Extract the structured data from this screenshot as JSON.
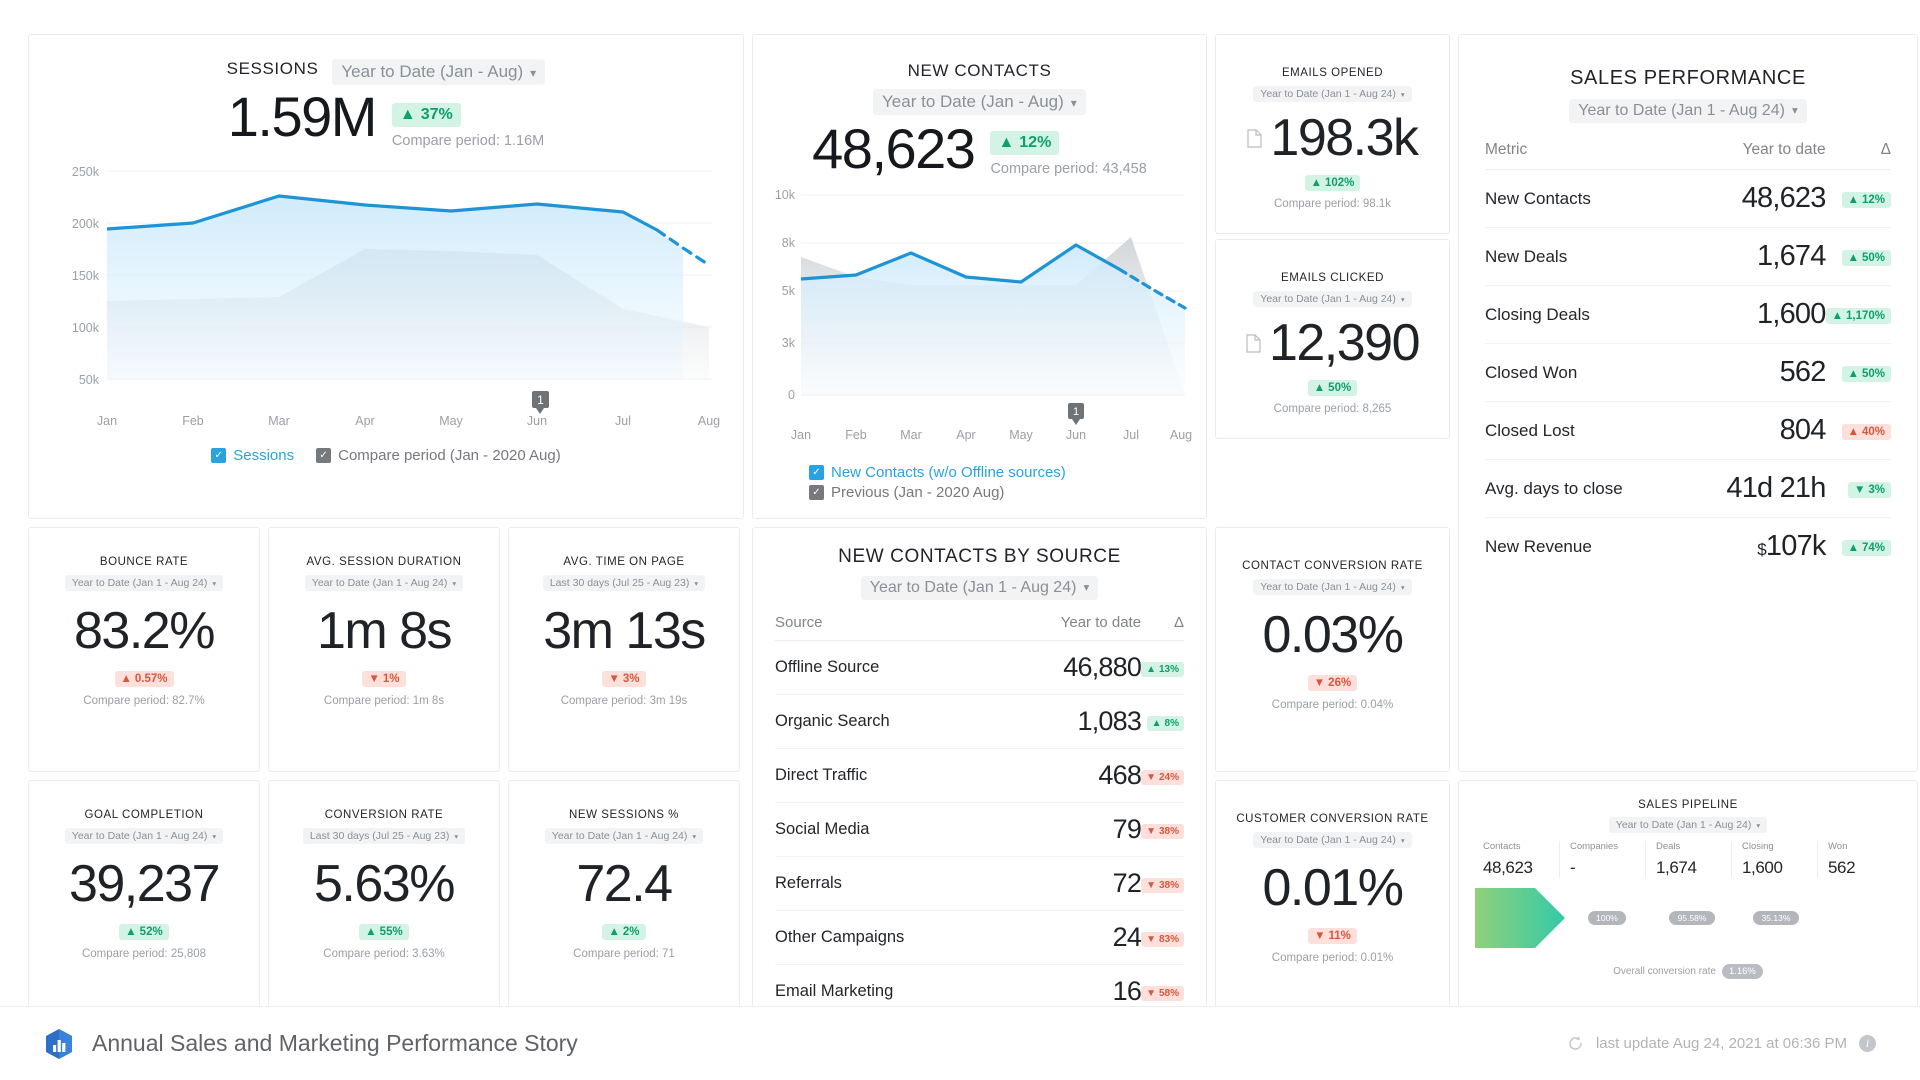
{
  "sessions": {
    "title": "SESSIONS",
    "period": "Year to Date (Jan - Aug)",
    "value": "1.59M",
    "delta": "37%",
    "delta_dir": "up",
    "compare": "Compare period: 1.16M",
    "legend": [
      {
        "label": "Sessions",
        "color": "blue"
      },
      {
        "label": "Compare period (Jan - 2020 Aug)",
        "color": "gray"
      }
    ]
  },
  "new_contacts": {
    "title": "NEW CONTACTS",
    "period": "Year to Date (Jan - Aug)",
    "value": "48,623",
    "delta": "12%",
    "delta_dir": "up",
    "compare": "Compare period: 43,458",
    "legend": [
      {
        "label": "New Contacts (w/o Offline sources)",
        "color": "blue"
      },
      {
        "label": "Previous (Jan - 2020 Aug)",
        "color": "gray"
      }
    ]
  },
  "emails_opened": {
    "title": "EMAILS OPENED",
    "period": "Year to Date (Jan 1 - Aug 24)",
    "value": "198.3k",
    "delta": "102%",
    "delta_dir": "up",
    "compare": "Compare period: 98.1k"
  },
  "emails_clicked": {
    "title": "EMAILS CLICKED",
    "period": "Year to Date (Jan 1 - Aug 24)",
    "value": "12,390",
    "delta": "50%",
    "delta_dir": "up",
    "compare": "Compare period: 8,265"
  },
  "sales_performance": {
    "title": "SALES PERFORMANCE",
    "period": "Year to Date (Jan 1 - Aug 24)",
    "columns": {
      "metric": "Metric",
      "value": "Year to date",
      "delta": "Δ"
    },
    "rows": [
      {
        "metric": "New Contacts",
        "value": "48,623",
        "currency": "",
        "delta": "12%",
        "dir": "up",
        "arrow": "▲",
        "tone": "up"
      },
      {
        "metric": "New Deals",
        "value": "1,674",
        "currency": "",
        "delta": "50%",
        "dir": "up",
        "arrow": "▲",
        "tone": "up"
      },
      {
        "metric": "Closing Deals",
        "value": "1,600",
        "currency": "",
        "delta": "1,170%",
        "dir": "up",
        "arrow": "▲",
        "tone": "up"
      },
      {
        "metric": "Closed Won",
        "value": "562",
        "currency": "",
        "delta": "50%",
        "dir": "up",
        "arrow": "▲",
        "tone": "up"
      },
      {
        "metric": "Closed Lost",
        "value": "804",
        "currency": "",
        "delta": "40%",
        "dir": "up",
        "arrow": "▲",
        "tone": "down"
      },
      {
        "metric": "Avg. days to close",
        "value": "41d 21h",
        "currency": "",
        "delta": "3%",
        "dir": "down",
        "arrow": "▼",
        "tone": "up"
      },
      {
        "metric": "New Revenue",
        "value": "107k",
        "currency": "$",
        "delta": "74%",
        "dir": "up",
        "arrow": "▲",
        "tone": "up"
      }
    ]
  },
  "kpis": [
    {
      "id": "bounce-rate",
      "title": "BOUNCE RATE",
      "period": "Year to Date (Jan 1 - Aug 24)",
      "value": "83.2%",
      "delta": "0.57%",
      "arrow": "▲",
      "tone": "down",
      "compare": "Compare period: 82.7%"
    },
    {
      "id": "avg-session",
      "title": "AVG. SESSION DURATION",
      "period": "Year to Date (Jan 1 - Aug 24)",
      "value": "1m 8s",
      "delta": "1%",
      "arrow": "▼",
      "tone": "down",
      "compare": "Compare period: 1m 8s"
    },
    {
      "id": "avg-time",
      "title": "AVG. TIME ON PAGE",
      "period": "Last 30 days (Jul 25 - Aug 23)",
      "value": "3m 13s",
      "delta": "3%",
      "arrow": "▼",
      "tone": "down",
      "compare": "Compare period: 3m 19s"
    },
    {
      "id": "goal-completion",
      "title": "GOAL COMPLETION",
      "period": "Year to Date (Jan 1 - Aug 24)",
      "value": "39,237",
      "delta": "52%",
      "arrow": "▲",
      "tone": "up",
      "compare": "Compare period: 25,808"
    },
    {
      "id": "conversion-rate",
      "title": "CONVERSION RATE",
      "period": "Last 30 days (Jul 25 - Aug 23)",
      "value": "5.63%",
      "delta": "55%",
      "arrow": "▲",
      "tone": "up",
      "compare": "Compare period: 3.63%"
    },
    {
      "id": "new-sessions",
      "title": "NEW SESSIONS %",
      "period": "Year to Date (Jan 1 - Aug 24)",
      "value": "72.4",
      "delta": "2%",
      "arrow": "▲",
      "tone": "up",
      "compare": "Compare period: 71"
    }
  ],
  "contacts_by_source": {
    "title": "NEW CONTACTS BY SOURCE",
    "period": "Year to Date (Jan 1 - Aug 24)",
    "columns": {
      "source": "Source",
      "value": "Year to date",
      "delta": "Δ"
    },
    "rows": [
      {
        "source": "Offline Source",
        "value": "46,880",
        "delta": "13%",
        "arrow": "▲",
        "tone": "up"
      },
      {
        "source": "Organic Search",
        "value": "1,083",
        "delta": "8%",
        "arrow": "▲",
        "tone": "up"
      },
      {
        "source": "Direct Traffic",
        "value": "468",
        "delta": "24%",
        "arrow": "▼",
        "tone": "down"
      },
      {
        "source": "Social Media",
        "value": "79",
        "delta": "38%",
        "arrow": "▼",
        "tone": "down"
      },
      {
        "source": "Referrals",
        "value": "72",
        "delta": "38%",
        "arrow": "▼",
        "tone": "down"
      },
      {
        "source": "Other Campaigns",
        "value": "24",
        "delta": "83%",
        "arrow": "▼",
        "tone": "down"
      },
      {
        "source": "Email Marketing",
        "value": "16",
        "delta": "58%",
        "arrow": "▼",
        "tone": "down"
      }
    ]
  },
  "contact_conversion": {
    "title": "CONTACT CONVERSION RATE",
    "period": "Year to Date (Jan 1 - Aug 24)",
    "value": "0.03%",
    "delta": "26%",
    "arrow": "▼",
    "tone": "down",
    "compare": "Compare period: 0.04%"
  },
  "customer_conversion": {
    "title": "CUSTOMER CONVERSION RATE",
    "period": "Year to Date (Jan 1 - Aug 24)",
    "value": "0.01%",
    "delta": "11%",
    "arrow": "▼",
    "tone": "down",
    "compare": "Compare period: 0.01%"
  },
  "pipeline": {
    "title": "SALES PIPELINE",
    "period": "Year to Date (Jan 1 - Aug 24)",
    "stages": [
      {
        "label": "Contacts",
        "value": "48,623",
        "rate": ""
      },
      {
        "label": "Companies",
        "value": "-",
        "rate": ""
      },
      {
        "label": "Deals",
        "value": "1,674",
        "rate": "100%"
      },
      {
        "label": "Closing",
        "value": "1,600",
        "rate": "95.58%"
      },
      {
        "label": "Won",
        "value": "562",
        "rate": "35.13%"
      }
    ],
    "overall_label": "Overall conversion rate",
    "overall_value": "1.16%"
  },
  "footer": {
    "title": "Annual Sales and Marketing Performance Story",
    "last_update": "last update Aug 24, 2021 at 06:36 PM"
  },
  "colors": {
    "accent_blue": "#29a3e0",
    "up_bg": "#d3f3e4",
    "up_fg": "#0e9f6e",
    "down_bg": "#fde0db",
    "down_fg": "#d7563c"
  },
  "chart_data": [
    {
      "type": "area",
      "title": "SESSIONS",
      "categories": [
        "Jan",
        "Feb",
        "Mar",
        "Apr",
        "May",
        "Jun",
        "Jul",
        "Aug"
      ],
      "ylim": [
        50000,
        250000
      ],
      "yticks": [
        50000,
        100000,
        150000,
        200000,
        250000
      ],
      "ytick_labels": [
        "50k",
        "100k",
        "150k",
        "200k",
        "250k"
      ],
      "xlabel": "",
      "ylabel": "",
      "grid": true,
      "legend_position": "bottom",
      "series": [
        {
          "name": "Sessions",
          "color": "#29a3e0",
          "values": [
            196000,
            202000,
            228000,
            220000,
            214000,
            221000,
            214000,
            180000
          ],
          "forecast_from": 7,
          "forecast_value": 155000
        },
        {
          "name": "Compare period (Jan - 2020 Aug)",
          "color": "#b9bdc1",
          "values": [
            140000,
            142000,
            143000,
            190000,
            188000,
            185000,
            150000,
            133000
          ]
        }
      ]
    },
    {
      "type": "area",
      "title": "NEW CONTACTS",
      "categories": [
        "Jan",
        "Feb",
        "Mar",
        "Apr",
        "May",
        "Jun",
        "Jul",
        "Aug"
      ],
      "ylim": [
        0,
        10000
      ],
      "yticks": [
        0,
        3000,
        5000,
        8000,
        10000
      ],
      "ytick_labels": [
        "0",
        "3k",
        "5k",
        "8k",
        "10k"
      ],
      "xlabel": "",
      "ylabel": "",
      "grid": true,
      "legend_position": "bottom",
      "series": [
        {
          "name": "New Contacts (w/o Offline sources)",
          "color": "#29a3e0",
          "values": [
            6300,
            6500,
            7200,
            6350,
            6100,
            7900,
            6400,
            4600
          ],
          "forecast_from": 6,
          "forecast_value": 4600
        },
        {
          "name": "Previous (Jan - 2020 Aug)",
          "color": "#b9bdc1",
          "values": [
            7100,
            6000,
            5700,
            5700,
            5700,
            5700,
            8400,
            0
          ]
        }
      ]
    },
    {
      "type": "funnel",
      "title": "SALES PIPELINE",
      "categories": [
        "Contacts",
        "Companies",
        "Deals",
        "Closing",
        "Won"
      ],
      "values": [
        48623,
        null,
        1674,
        1600,
        562
      ],
      "rates": [
        null,
        null,
        "100%",
        "95.58%",
        "35.13%"
      ],
      "overall_conversion_rate": "1.16%"
    }
  ]
}
